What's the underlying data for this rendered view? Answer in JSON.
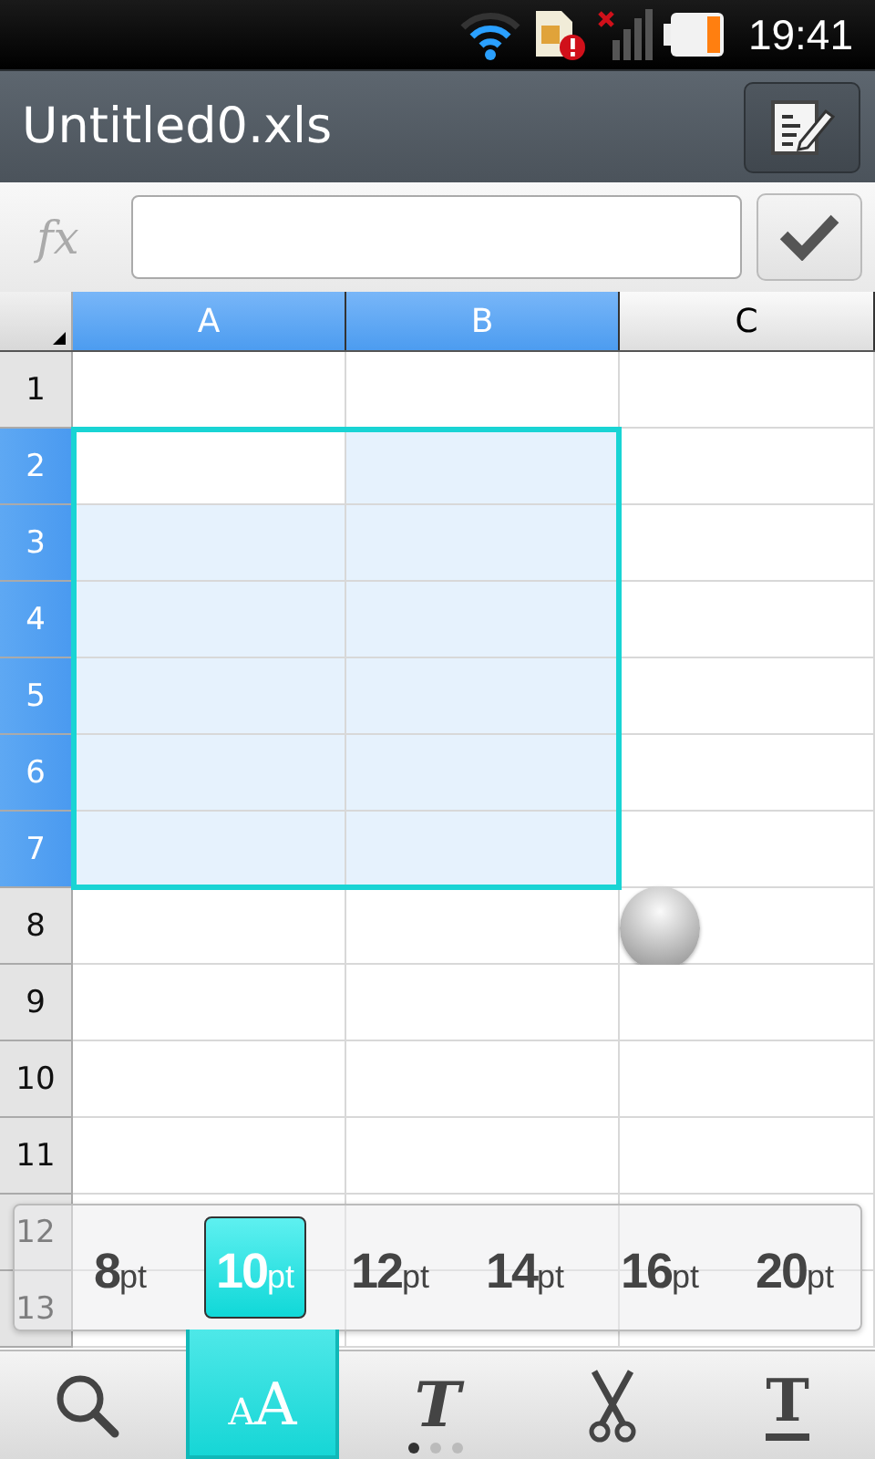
{
  "status_bar": {
    "time": "19:41"
  },
  "title_bar": {
    "title": "Untitled0.xls"
  },
  "formula_bar": {
    "label": "fx"
  },
  "sheet": {
    "columns": [
      {
        "label": "A",
        "selected": true
      },
      {
        "label": "B",
        "selected": true
      },
      {
        "label": "C",
        "selected": false
      }
    ],
    "rows": [
      {
        "label": "1",
        "selected": false
      },
      {
        "label": "2",
        "selected": true
      },
      {
        "label": "3",
        "selected": true
      },
      {
        "label": "4",
        "selected": true
      },
      {
        "label": "5",
        "selected": true
      },
      {
        "label": "6",
        "selected": true
      },
      {
        "label": "7",
        "selected": true
      },
      {
        "label": "8",
        "selected": false
      },
      {
        "label": "9",
        "selected": false
      },
      {
        "label": "10",
        "selected": false
      },
      {
        "label": "11",
        "selected": false
      },
      {
        "label": "12",
        "selected": false
      },
      {
        "label": "13",
        "selected": false
      }
    ]
  },
  "font_sizes": [
    {
      "value": "8",
      "unit": "pt",
      "selected": false
    },
    {
      "value": "10",
      "unit": "pt",
      "selected": true
    },
    {
      "value": "12",
      "unit": "pt",
      "selected": false
    },
    {
      "value": "14",
      "unit": "pt",
      "selected": false
    },
    {
      "value": "16",
      "unit": "pt",
      "selected": false
    },
    {
      "value": "20",
      "unit": "pt",
      "selected": false
    }
  ],
  "toolbar": {
    "tools": [
      {
        "kind": "search",
        "selected": false
      },
      {
        "kind": "font-size",
        "small": "A",
        "large": "A",
        "selected": true
      },
      {
        "kind": "italic",
        "glyph": "T",
        "selected": false
      },
      {
        "kind": "cut",
        "selected": false
      },
      {
        "kind": "underline",
        "glyph": "T",
        "selected": false
      }
    ],
    "pages": [
      {
        "selected": true
      },
      {
        "selected": false
      },
      {
        "selected": false
      }
    ]
  }
}
